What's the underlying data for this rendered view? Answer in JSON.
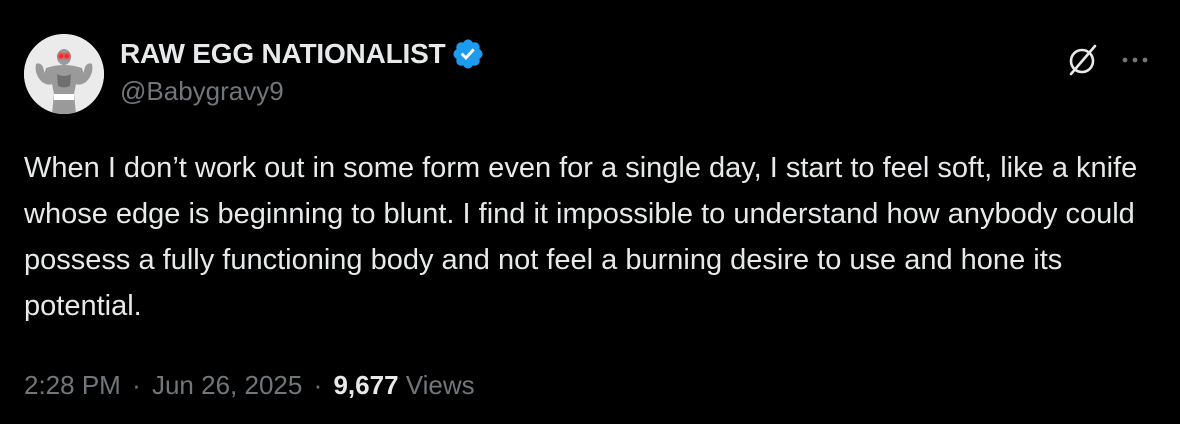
{
  "author": {
    "display_name": "RAW EGG NATIONALIST",
    "handle": "@Babygravy9",
    "verified_badge_color": "#1d9bf0"
  },
  "tweet": {
    "text": "When I don’t work out in some form even for a single day, I start to feel soft, like a knife whose edge is beginning to blunt. I find it impossible to understand how anybody could possess a fully functioning body and not feel a burning desire to use and hone its potential.",
    "time": "2:28 PM",
    "date": "Jun 26, 2025",
    "separator": "·",
    "views_count": "9,677",
    "views_label": "Views"
  },
  "icons": {
    "verified": "verified-badge-icon",
    "grok": "grok-icon",
    "more": "more-options-icon"
  },
  "colors": {
    "background": "#000000",
    "primary_text": "#e7e9ea",
    "secondary_text": "#71767b",
    "accent": "#1d9bf0"
  }
}
